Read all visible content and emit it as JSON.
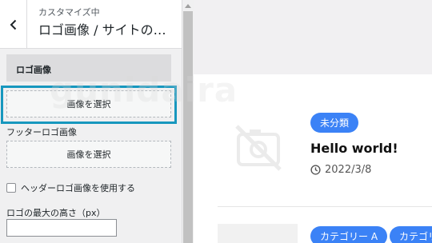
{
  "sidebar": {
    "back_icon": "chevron-left-icon",
    "subtitle": "カスタマイズ中",
    "title": "ロゴ画像 / サイトの…",
    "section_label": "ロゴ画像",
    "select_button_1": "画像を選択",
    "footer_logo_label": "フッターロゴ画像",
    "select_button_2": "画像を選択",
    "checkbox_label": "ヘッダーロゴ画像を使用する",
    "checkbox_checked": false,
    "max_height_label": "ロゴの最大の高さ（px）",
    "max_height_value": "",
    "highlight_color": "#1797be"
  },
  "preview": {
    "thumbnail_icon": "image-off-icon",
    "category_badge": "未分類",
    "post_title": "Hello world!",
    "date_icon": "clock-icon",
    "post_date": "2022/3/8",
    "tags": [
      "カテゴリー A",
      "カテゴリー"
    ],
    "badge_color": "#3b82f6"
  },
  "watermark": "gunidaira"
}
